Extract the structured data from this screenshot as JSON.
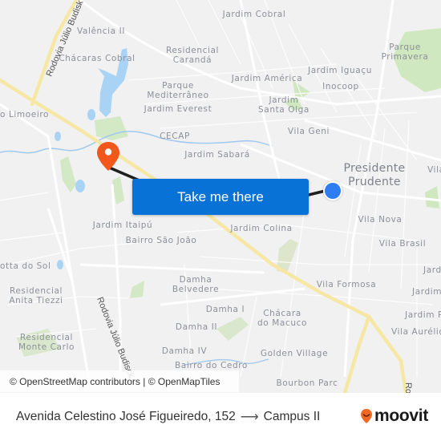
{
  "map": {
    "neighborhoods": [
      {
        "id": "jardim-cobral",
        "text": "Jardim Cobral"
      },
      {
        "id": "valencia-ii",
        "text": "Valência II"
      },
      {
        "id": "chacaras-cobral",
        "text": "Chácaras Cobral"
      },
      {
        "id": "residencial-caranda",
        "text": "Residencial\nCarandá"
      },
      {
        "id": "parque-primavera",
        "text": "Parque\nPrimavera"
      },
      {
        "id": "jardim-iguacu",
        "text": "Jardim Iguaçu"
      },
      {
        "id": "jardim-america",
        "text": "Jardim América"
      },
      {
        "id": "inocoop",
        "text": "Inocoop"
      },
      {
        "id": "parque-mediterraneo",
        "text": "Parque\nMediterrâneo"
      },
      {
        "id": "jardim-everest",
        "text": "Jardim Everest"
      },
      {
        "id": "jardim-santa-olga",
        "text": "Jardim\nSanta Olga"
      },
      {
        "id": "limoeiro",
        "text": "o Limoeiro"
      },
      {
        "id": "vila-geni",
        "text": "Vila Geni"
      },
      {
        "id": "cecap",
        "text": "CECAP"
      },
      {
        "id": "jardim-sabara",
        "text": "Jardim Sabará"
      },
      {
        "id": "vila-right",
        "text": "Vila"
      },
      {
        "id": "jardim-itaipu",
        "text": "Jardim Itaipú"
      },
      {
        "id": "vila-nova",
        "text": "Vila Nova"
      },
      {
        "id": "bairro-sao-joao",
        "text": "Bairro São João"
      },
      {
        "id": "jardim-colina",
        "text": "Jardim Colina"
      },
      {
        "id": "vila-brasil",
        "text": "Vila Brasil"
      },
      {
        "id": "otta-do-sol",
        "text": "otta do Sol"
      },
      {
        "id": "jardim-r1",
        "text": "Jardi"
      },
      {
        "id": "damha-belvedere",
        "text": "Damha\nBelvedere"
      },
      {
        "id": "vila-formosa",
        "text": "Vila Formosa"
      },
      {
        "id": "residencial-anita-tiezzi",
        "text": "Residencial\nAnita Tiezzi"
      },
      {
        "id": "jardim-r2",
        "text": "Jardim"
      },
      {
        "id": "damha-i",
        "text": "Damha I"
      },
      {
        "id": "chacara-do-macuco",
        "text": "Chácara\ndo Macuco"
      },
      {
        "id": "jardim-r3",
        "text": "Jardim P"
      },
      {
        "id": "damha-ii",
        "text": "Damha II"
      },
      {
        "id": "residencial-monte-carlo",
        "text": "Residencial\nMonte Carlo"
      },
      {
        "id": "vila-aurelio",
        "text": "Vila Aurélio"
      },
      {
        "id": "damha-iv",
        "text": "Damha IV"
      },
      {
        "id": "golden-village",
        "text": "Golden Village"
      },
      {
        "id": "bairro-do-cedro",
        "text": "Bairro do Cedro"
      },
      {
        "id": "bourbon-parc",
        "text": "Bourbon Parc"
      }
    ],
    "city": "Presidente\nPrudente",
    "roads": {
      "top": "Rodovia Júlio Budisk",
      "bottom": "Rodovia Júlio Budisck",
      "right": "Ro"
    },
    "colors": {
      "background": "#f1f1f2",
      "road": "#ffffff",
      "highway": "#f7e7a4",
      "water": "#a9d3f5",
      "park": "#cfe8bf",
      "route_line": "#1f1f1f",
      "origin_marker": "#f2581c",
      "destination_marker": "#2f7ef1",
      "cta_button": "#0872d6"
    }
  },
  "cta": {
    "label": "Take me there"
  },
  "attribution": "© OpenStreetMap contributors | © OpenMapTiles",
  "footer": {
    "origin": "Avenida Celestino José Figueiredo, 152",
    "arrow": "⟶",
    "destination": "Campus II",
    "brand": "moovit",
    "brand_color": "#f26822"
  }
}
